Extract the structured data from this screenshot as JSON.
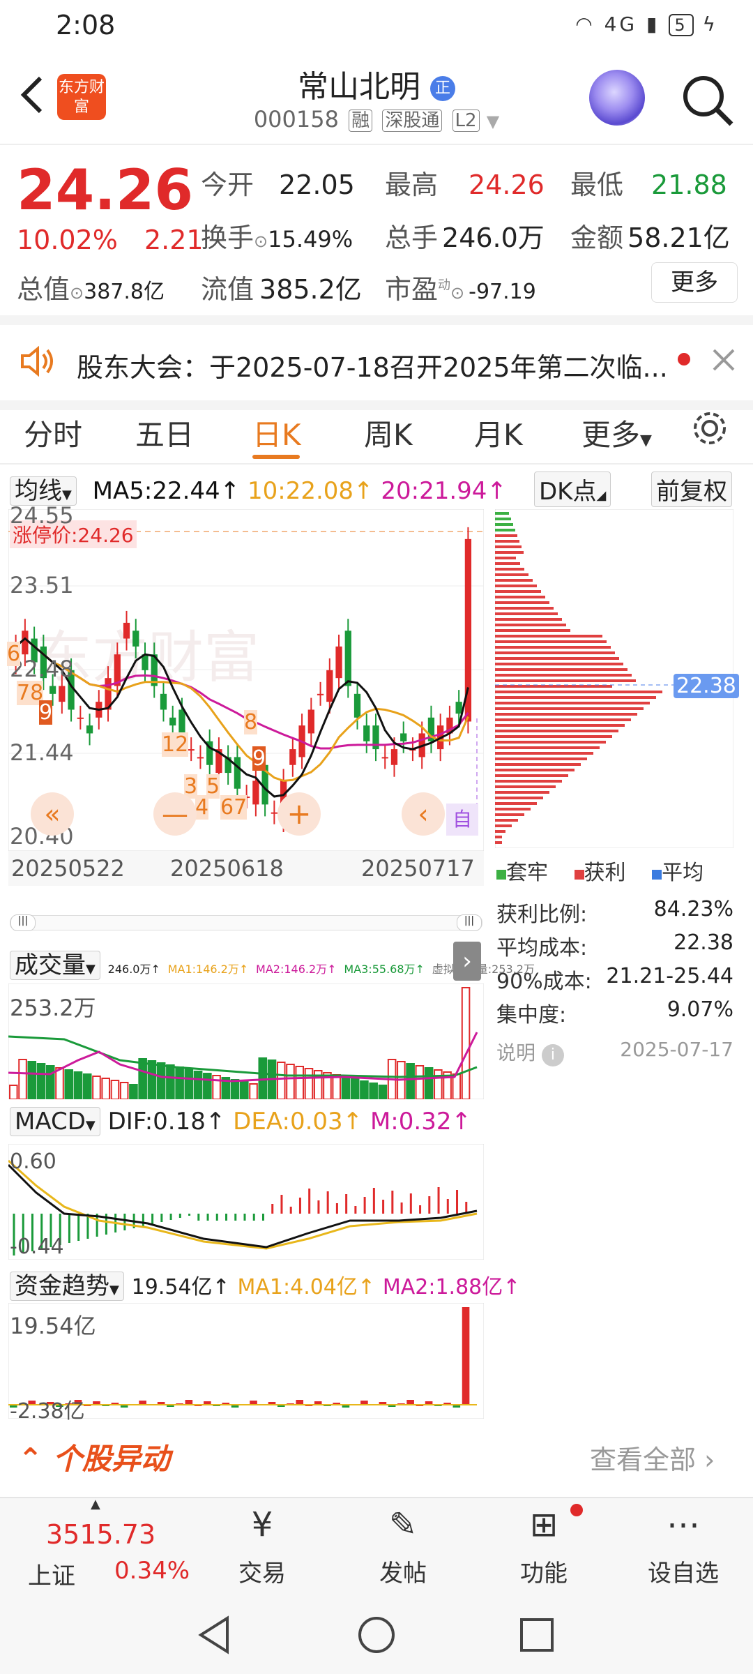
{
  "status": {
    "time": "2:08",
    "battery": "5",
    "network": "4G"
  },
  "header": {
    "logo": "东方财富",
    "name": "常山北明",
    "code": "000158",
    "tags": [
      "融",
      "深股通",
      "L2"
    ]
  },
  "quote": {
    "price": "24.26",
    "pct": "10.02%",
    "change": "2.21",
    "open_label": "今开",
    "open": "22.05",
    "high_label": "最高",
    "high": "24.26",
    "low_label": "最低",
    "low": "21.88",
    "turnover_label": "换手",
    "turnover": "15.49%",
    "volume_label": "总手",
    "volume": "246.0万",
    "amount_label": "金额",
    "amount": "58.21亿",
    "mktcap_label": "总值",
    "mktcap": "387.8亿",
    "float_label": "流值",
    "float": "385.2亿",
    "pe_label": "市盈",
    "pe_sup": "动",
    "pe": "-97.19",
    "more": "更多"
  },
  "notice": {
    "text": "股东大会：于2025-07-18召开2025年第二次临..."
  },
  "tabs": [
    "分时",
    "五日",
    "日K",
    "周K",
    "月K",
    "更多"
  ],
  "kline": {
    "ma_selector": "均线",
    "ma5": "MA5:22.44↑",
    "ma10": "10:22.08↑",
    "ma20": "20:21.94↑",
    "dk": "DK点",
    "adjust": "前复权",
    "limit_label": "涨停价:24.26",
    "yticks": [
      "24.55",
      "23.51",
      "22.48",
      "21.44",
      "20.40"
    ],
    "dates": [
      "20250522",
      "20250618",
      "20250717"
    ],
    "signals": [
      "6",
      "78",
      "9",
      "12",
      "3",
      "5",
      "4",
      "67",
      "8",
      "9"
    ],
    "auto": "自"
  },
  "chip": {
    "price_tag": "22.38",
    "legend": [
      "套牢",
      "获利",
      "平均"
    ],
    "rows": [
      {
        "label": "获利比例:",
        "value": "84.23%"
      },
      {
        "label": "平均成本:",
        "value": "22.38"
      },
      {
        "label": "90%成本:",
        "value": "21.21-25.44"
      },
      {
        "label": "集中度:",
        "value": "9.07%"
      }
    ],
    "note_label": "说明",
    "note_date": "2025-07-17"
  },
  "volume": {
    "selector": "成交量",
    "legend": [
      "246.0万↑",
      "MA1:146.2万↑",
      "MA2:146.2万↑",
      "MA3:55.68万↑",
      "虚拟成交量:253.2万"
    ],
    "ytop": "253.2万"
  },
  "macd": {
    "selector": "MACD",
    "dif": "DIF:0.18↑",
    "dea": "DEA:0.03↑",
    "m": "M:0.32↑",
    "ytop": "0.60",
    "ybot": "-0.44"
  },
  "fund": {
    "selector": "资金趋势",
    "v": "19.54亿↑",
    "ma1": "MA1:4.04亿↑",
    "ma2": "MA2:1.88亿↑",
    "ytop": "19.54亿",
    "ybot": "-2.38亿"
  },
  "banner": {
    "title": "个股异动",
    "more": "查看全部"
  },
  "bottom": {
    "index_value": "3515.73",
    "index_name": "上证",
    "index_pct": "0.34%",
    "items": [
      "交易",
      "发帖",
      "功能",
      "设自选"
    ]
  },
  "colors": {
    "up": "#e02a2a",
    "down": "#1a9a3a",
    "accent": "#e87a20",
    "ma5": "#111111",
    "ma10": "#e8a21b",
    "ma20": "#cc1a9a"
  },
  "chart_data": {
    "type": "candlestick",
    "ylim": [
      20.4,
      24.55
    ],
    "limit_price": 24.26,
    "last_close": 24.26,
    "avg_cost": 22.38
  }
}
